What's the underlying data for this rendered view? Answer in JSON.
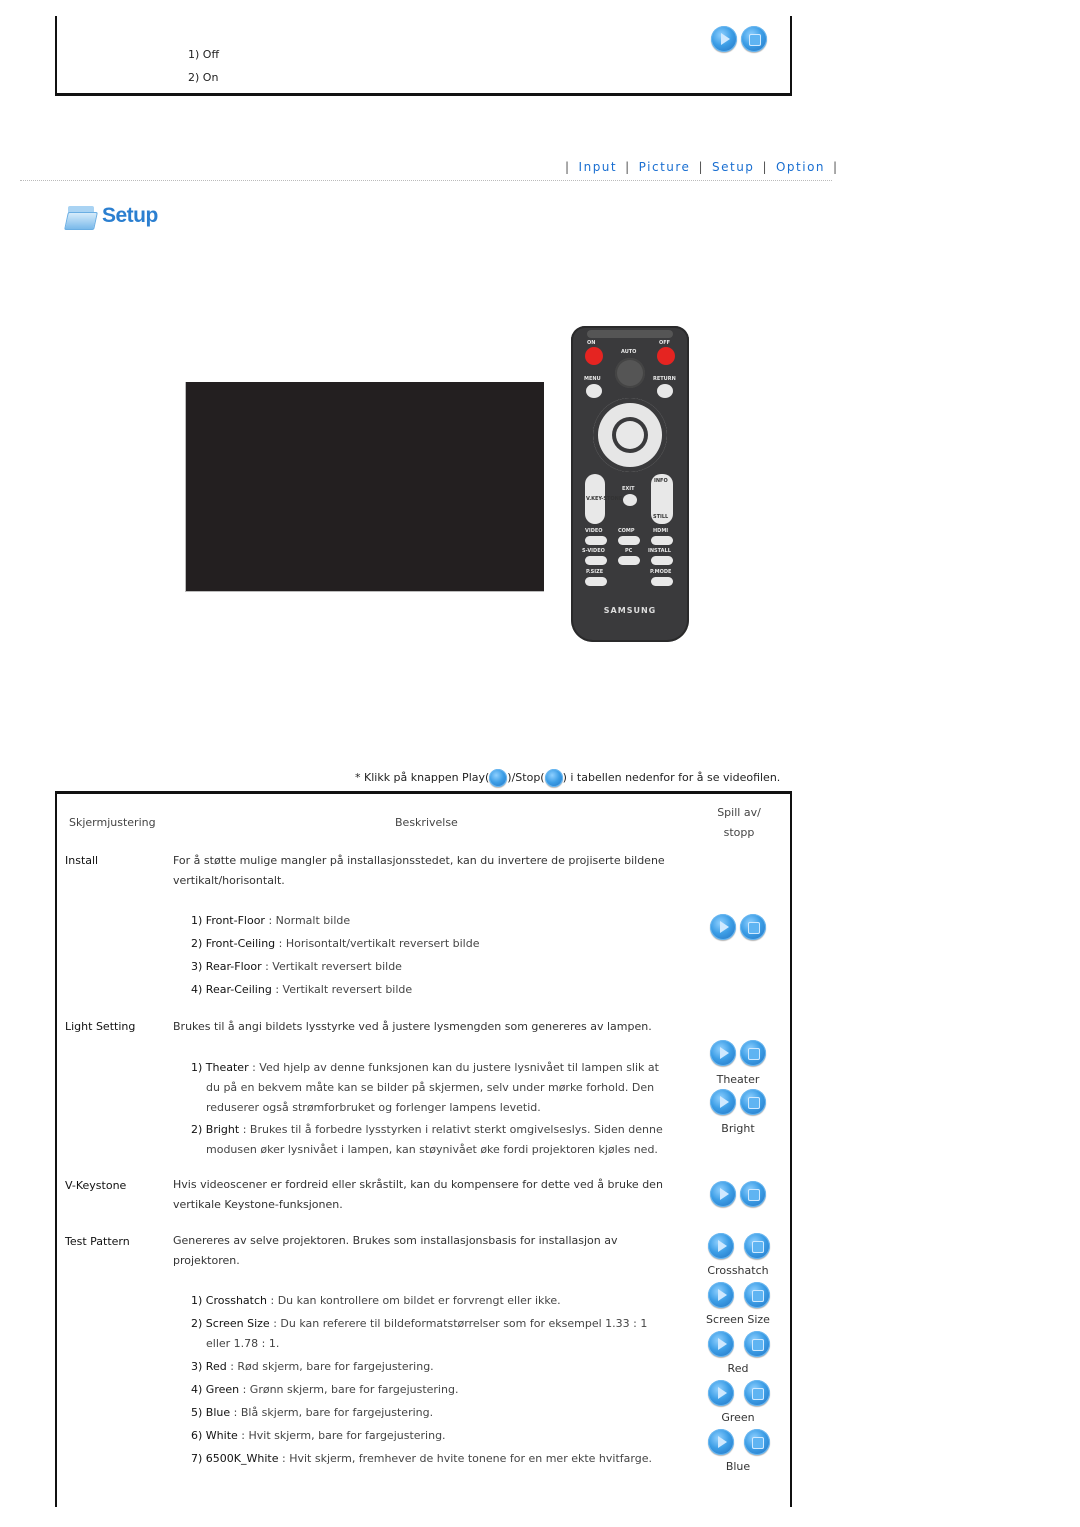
{
  "top_section": {
    "options": [
      "1) Off",
      "2) On"
    ],
    "controls": {
      "play": "play-button",
      "stop": "stop-button"
    }
  },
  "nav": {
    "items": [
      "Input",
      "Picture",
      "Setup",
      "Option"
    ],
    "separator": "|"
  },
  "heading": {
    "title": "Setup",
    "icon": "folder-icon"
  },
  "remote": {
    "labels": {
      "on": "ON",
      "off": "OFF",
      "auto": "AUTO",
      "menu": "MENU",
      "return": "RETURN",
      "exit": "EXIT",
      "info": "INFO",
      "still": "STILL",
      "vkeystone": "V.KEY-STONE",
      "video": "VIDEO",
      "comp": "COMP",
      "hdmi": "HDMI",
      "svideo": "S-VIDEO",
      "pc": "PC",
      "install": "INSTALL",
      "psize": "P.SIZE",
      "pmode": "P.MODE",
      "brand": "SAMSUNG"
    }
  },
  "note": {
    "prefix": "* Klikk på knappen Play(",
    "middle": ")/Stop(",
    "suffix": ") i tabellen nedenfor for å se videofilen."
  },
  "table": {
    "headers": {
      "col1": "Skjermjustering",
      "col2": "Beskrivelse",
      "col3_line1": "Spill av/",
      "col3_line2": "stopp"
    },
    "rows": [
      {
        "label": "Install",
        "desc_lines": [
          "For å støtte mulige mangler på installasjonsstedet, kan du invertere de projiserte bildene",
          "vertikalt/horisontalt."
        ],
        "items": [
          {
            "num": "1)",
            "name": "Front-Floor",
            "text": " : Normalt bilde"
          },
          {
            "num": "2)",
            "name": "Front-Ceiling",
            "text": " : Horisontalt/vertikalt reversert bilde"
          },
          {
            "num": "3)",
            "name": "Rear-Floor",
            "text": " : Vertikalt reversert bilde"
          },
          {
            "num": "4)",
            "name": "Rear-Ceiling",
            "text": " : Vertikalt reversert bilde"
          }
        ]
      },
      {
        "label": "Light Setting",
        "desc_lines": [
          "Brukes til å angi bildets lysstyrke ved å justere lysmengden som genereres av lampen."
        ],
        "items": [
          {
            "num": "1)",
            "name": "Theater",
            "text": " : Ved hjelp av denne funksjonen kan du justere lysnivået til lampen slik at",
            "cont": [
              "du på en bekvem måte kan se bilder på skjermen, selv under mørke forhold. Den",
              "reduserer også strømforbruket og forlenger lampens levetid."
            ]
          },
          {
            "num": "2)",
            "name": "Bright",
            "text": " : Brukes til å forbedre lysstyrken i relativt sterkt omgivelseslys. Siden denne",
            "cont": [
              "modusen øker lysnivået i lampen, kan støynivået øke fordi projektoren kjøles ned."
            ]
          }
        ],
        "captions": [
          "Theater",
          "Bright"
        ]
      },
      {
        "label": "V-Keystone",
        "desc_lines": [
          "Hvis videoscener er fordreid eller skråstilt, kan du kompensere for dette ved å bruke den",
          "vertikale Keystone-funksjonen."
        ]
      },
      {
        "label": "Test Pattern",
        "desc_lines": [
          "Genereres av selve projektoren. Brukes som installasjonsbasis for installasjon av",
          "projektoren."
        ],
        "items": [
          {
            "num": "1)",
            "name": "Crosshatch",
            "text": " : Du kan kontrollere om bildet er forvrengt eller ikke."
          },
          {
            "num": "2)",
            "name": "Screen Size",
            "text": " : Du kan referere til bildeformatstørrelser som for eksempel 1.33 : 1",
            "cont": [
              "eller 1.78 : 1."
            ]
          },
          {
            "num": "3)",
            "name": "Red",
            "text": " : Rød skjerm, bare for fargejustering."
          },
          {
            "num": "4)",
            "name": "Green",
            "text": " : Grønn skjerm, bare for fargejustering."
          },
          {
            "num": "5)",
            "name": "Blue",
            "text": " : Blå skjerm, bare for fargejustering."
          },
          {
            "num": "6)",
            "name": "White",
            "text": " : Hvit skjerm, bare for fargejustering."
          },
          {
            "num": "7)",
            "name": "6500K_White",
            "text": " : Hvit skjerm, fremhever de hvite tonene for en mer ekte hvitfarge."
          }
        ],
        "captions": [
          "Crosshatch",
          "Screen Size",
          "Red",
          "Green",
          "Blue"
        ]
      }
    ]
  }
}
